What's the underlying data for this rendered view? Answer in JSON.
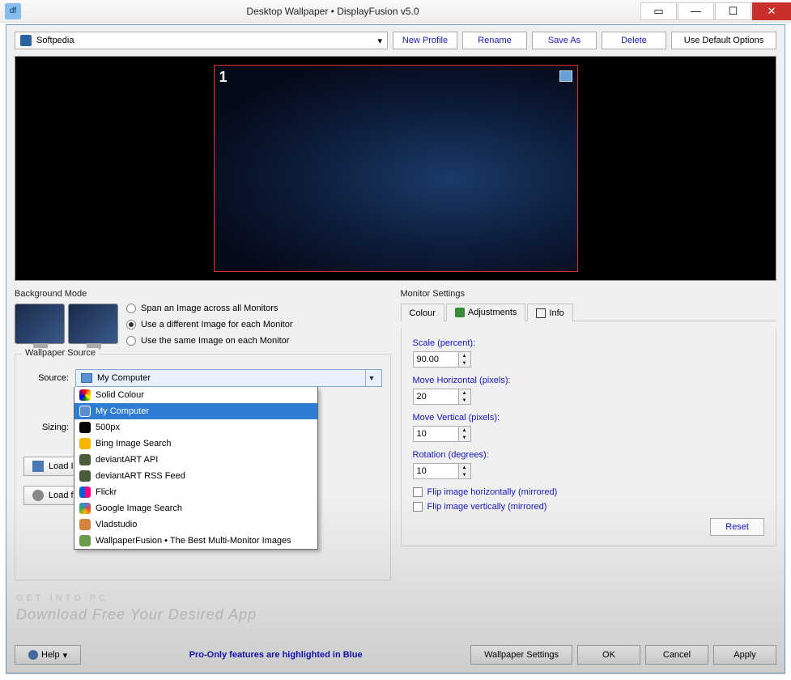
{
  "window": {
    "title": "Desktop Wallpaper • DisplayFusion v5.0"
  },
  "toolbar": {
    "profile_selected": "Softpedia",
    "new_profile": "New Profile",
    "rename": "Rename",
    "save_as": "Save As",
    "delete": "Delete",
    "use_defaults": "Use Default Options"
  },
  "preview": {
    "monitor_number": "1"
  },
  "background_mode": {
    "legend": "Background Mode",
    "options": [
      {
        "label": "Span an Image across all Monitors",
        "checked": false
      },
      {
        "label": "Use a different Image for each Monitor",
        "checked": true
      },
      {
        "label": "Use the same Image on each Monitor",
        "checked": false
      }
    ]
  },
  "wallpaper_source": {
    "legend": "Wallpaper Source",
    "source_label": "Source:",
    "sizing_label": "Sizing:",
    "selected": "My Computer",
    "options": [
      {
        "label": "Solid Colour",
        "icon": "i-colour"
      },
      {
        "label": "My Computer",
        "icon": "i-comp",
        "selected": true
      },
      {
        "label": "500px",
        "icon": "i-500"
      },
      {
        "label": "Bing Image Search",
        "icon": "i-bing"
      },
      {
        "label": "deviantART API",
        "icon": "i-da"
      },
      {
        "label": "deviantART RSS Feed",
        "icon": "i-da"
      },
      {
        "label": "Flickr",
        "icon": "i-flickr"
      },
      {
        "label": "Google Image Search",
        "icon": "i-google"
      },
      {
        "label": "Vladstudio",
        "icon": "i-vlad"
      },
      {
        "label": "WallpaperFusion • The Best Multi-Monitor Images",
        "icon": "i-wpf"
      }
    ],
    "load_image": "Load Image",
    "load_url": "Load from URL"
  },
  "monitor_settings": {
    "legend": "Monitor Settings",
    "tabs": {
      "colour": "Colour",
      "adjustments": "Adjustments",
      "info": "Info",
      "active": "adjustments"
    },
    "scale": {
      "label": "Scale (percent):",
      "value": "90.00"
    },
    "move_h": {
      "label": "Move Horizontal (pixels):",
      "value": "20"
    },
    "move_v": {
      "label": "Move Vertical (pixels):",
      "value": "10"
    },
    "rotation": {
      "label": "Rotation (degrees):",
      "value": "10"
    },
    "flip_h": "Flip image horizontally (mirrored)",
    "flip_v": "Flip image vertically (mirrored)",
    "reset": "Reset"
  },
  "footer": {
    "help": "Help",
    "pro_note": "Pro-Only features are highlighted in Blue",
    "wallpaper_settings": "Wallpaper Settings",
    "ok": "OK",
    "cancel": "Cancel",
    "apply": "Apply"
  },
  "watermark": {
    "main": "GET INTO PC",
    "sub": "Download Free Your Desired App"
  }
}
